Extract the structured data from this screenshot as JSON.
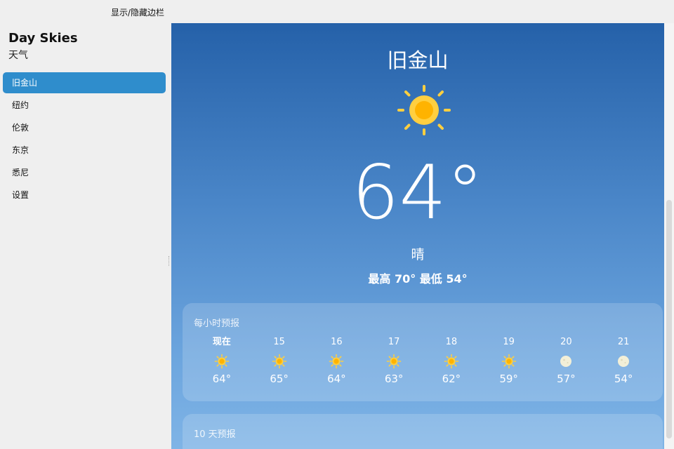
{
  "toolbar": {
    "toggle_label": "显示/隐藏边栏"
  },
  "sidebar": {
    "app_title": "Day Skies",
    "app_subtitle": "天气",
    "items": [
      {
        "label": "旧金山",
        "active": true
      },
      {
        "label": "纽约"
      },
      {
        "label": "伦敦"
      },
      {
        "label": "东京"
      },
      {
        "label": "悉尼"
      },
      {
        "label": "设置"
      }
    ]
  },
  "weather": {
    "city": "旧金山",
    "temperature": "64°",
    "condition": "晴",
    "hilo": "最高 70° 最低 54°"
  },
  "hourly": {
    "title": "每小时预报",
    "items": [
      {
        "time": "现在",
        "icon": "sun-icon",
        "temp": "64°"
      },
      {
        "time": "15",
        "icon": "sun-icon",
        "temp": "65°"
      },
      {
        "time": "16",
        "icon": "sun-icon",
        "temp": "64°"
      },
      {
        "time": "17",
        "icon": "sun-icon",
        "temp": "63°"
      },
      {
        "time": "18",
        "icon": "sun-icon",
        "temp": "62°"
      },
      {
        "time": "19",
        "icon": "sun-icon",
        "temp": "59°"
      },
      {
        "time": "20",
        "icon": "moon-icon",
        "temp": "57°"
      },
      {
        "time": "21",
        "icon": "moon-icon",
        "temp": "54°"
      }
    ]
  },
  "daily": {
    "title": "10 天预报"
  },
  "colors": {
    "accent": "#2f8dcc",
    "sun": "#ffb300",
    "sun_ray": "#ffcf40",
    "moon": "#f2efd8",
    "sky_top": "#2561a9",
    "sky_bottom": "#7fb4e6"
  }
}
